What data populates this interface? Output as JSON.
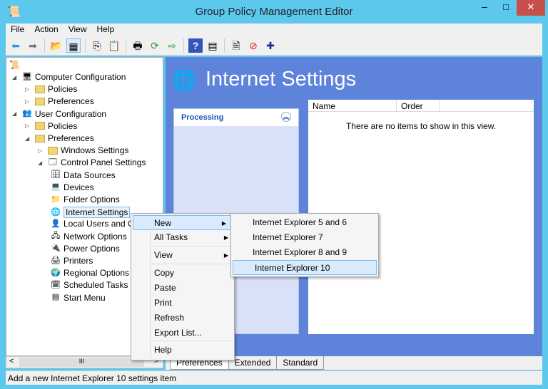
{
  "window": {
    "title": "Group Policy Management Editor",
    "buttons": [
      "–",
      "□",
      "✕"
    ]
  },
  "menubar": [
    "File",
    "Action",
    "View",
    "Help"
  ],
  "toolbar": {
    "icons": [
      "back-icon",
      "forward-icon",
      "up-folder-icon",
      "show-hide-tree-icon",
      "copy-icon",
      "paste-icon",
      "print-icon",
      "refresh-icon",
      "export-icon",
      "help-icon",
      "properties-icon",
      "new-item-icon",
      "stop-icon",
      "add-icon"
    ],
    "glyphs": [
      "⬅",
      "➡",
      "📂",
      "▦",
      "⎘",
      "📋",
      "🖶",
      "⟳",
      "⇨",
      "?",
      "▤",
      "🗎",
      "⊘",
      "✚"
    ]
  },
  "tree": [
    {
      "label": "Computer Configuration",
      "icon": "computer-icon"
    },
    {
      "label": "Policies",
      "icon": "folder-icon"
    },
    {
      "label": "Preferences",
      "icon": "folder-icon"
    },
    {
      "label": "User Configuration",
      "icon": "user-icon"
    },
    {
      "label": "Policies",
      "icon": "folder-icon"
    },
    {
      "label": "Preferences",
      "icon": "folder-icon"
    },
    {
      "label": "Windows Settings",
      "icon": "folder-icon"
    },
    {
      "label": "Control Panel Settings",
      "icon": "control-panel-icon"
    },
    {
      "label": "Data Sources",
      "icon": "data-sources-icon"
    },
    {
      "label": "Devices",
      "icon": "devices-icon"
    },
    {
      "label": "Folder Options",
      "icon": "folder-options-icon"
    },
    {
      "label": "Internet Settings",
      "icon": "internet-settings-icon"
    },
    {
      "label": "Local Users and Groups",
      "icon": "local-users-icon"
    },
    {
      "label": "Network Options",
      "icon": "network-options-icon"
    },
    {
      "label": "Power Options",
      "icon": "power-options-icon"
    },
    {
      "label": "Printers",
      "icon": "printers-icon"
    },
    {
      "label": "Regional Options",
      "icon": "regional-options-icon"
    },
    {
      "label": "Scheduled Tasks",
      "icon": "scheduled-tasks-icon"
    },
    {
      "label": "Start Menu",
      "icon": "start-menu-icon"
    }
  ],
  "right": {
    "title": "Internet Settings",
    "processing": "Processing",
    "columns": [
      "Name",
      "Order"
    ],
    "empty": "There are no items to show in this view."
  },
  "tabs": [
    "Preferences",
    "Extended",
    "Standard"
  ],
  "status": "Add a new Internet Explorer 10 settings item",
  "context_menu": [
    "New",
    "All Tasks",
    "View",
    "Copy",
    "Paste",
    "Print",
    "Refresh",
    "Export List...",
    "Help"
  ],
  "submenu": [
    "Internet Explorer 5 and 6",
    "Internet Explorer 7",
    "Internet Explorer 8 and 9",
    "Internet Explorer 10"
  ],
  "colors": {
    "frame": "#5cc8ee",
    "pane": "#5d83db",
    "highlight": "#d8eafc"
  }
}
